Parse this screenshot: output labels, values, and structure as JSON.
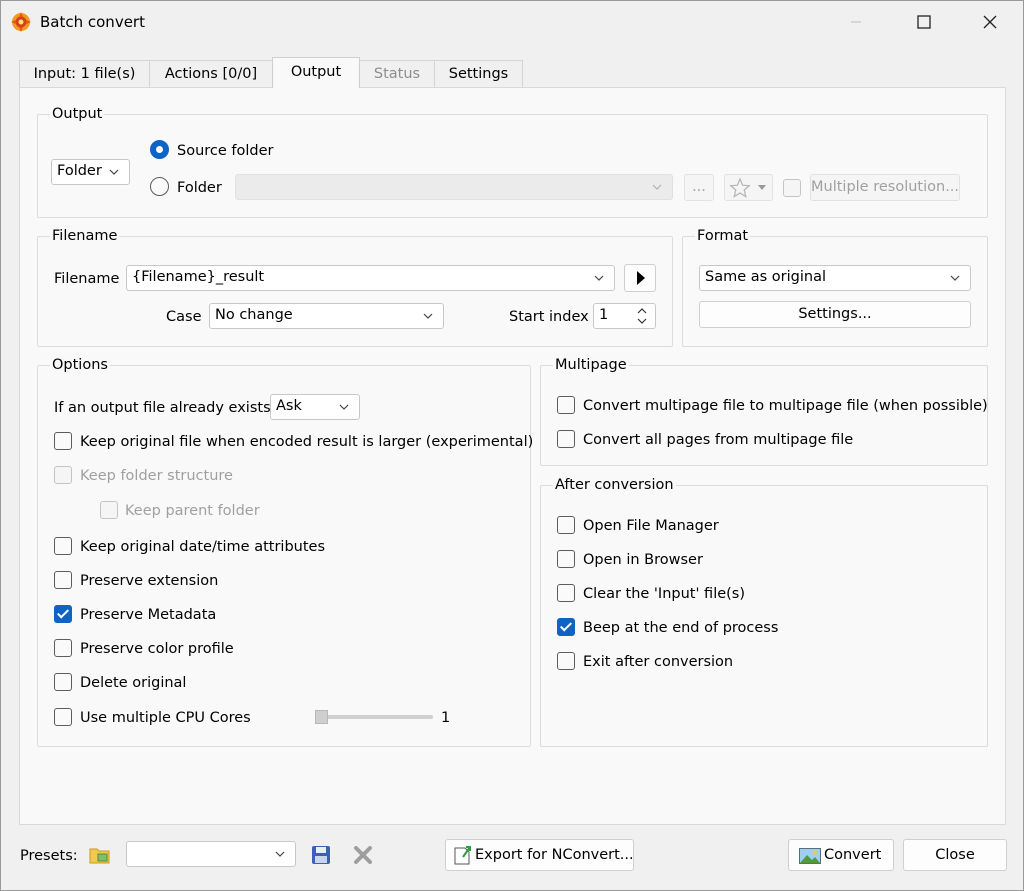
{
  "window": {
    "title": "Batch convert"
  },
  "tabs": [
    {
      "label": "Input: 1 file(s)"
    },
    {
      "label": "Actions [0/0]"
    },
    {
      "label": "Output"
    },
    {
      "label": "Status"
    },
    {
      "label": "Settings"
    }
  ],
  "output": {
    "group_label": "Output",
    "mode_select": "Folder",
    "source_folder_label": "Source folder",
    "folder_label": "Folder",
    "folder_value": "",
    "browse_label": "...",
    "multiple_resolution_label": "Multiple resolution..."
  },
  "filename": {
    "group_label": "Filename",
    "label": "Filename",
    "value": "{Filename}_result",
    "case_label": "Case",
    "case_value": "No change",
    "start_index_label": "Start index",
    "start_index_value": "1"
  },
  "format": {
    "group_label": "Format",
    "value": "Same as original",
    "settings_button": "Settings..."
  },
  "options": {
    "group_label": "Options",
    "exists_label": "If an output file already exists",
    "exists_value": "Ask",
    "keep_original_larger": "Keep original file when encoded result is larger (experimental)",
    "keep_folder_structure": "Keep folder structure",
    "keep_parent_folder": "Keep parent folder",
    "keep_datetime": "Keep original date/time attributes",
    "preserve_extension": "Preserve extension",
    "preserve_metadata": "Preserve Metadata",
    "preserve_color_profile": "Preserve color profile",
    "delete_original": "Delete original",
    "use_multiple_cpu": "Use multiple CPU Cores",
    "cpu_cores_value": "1"
  },
  "multipage": {
    "group_label": "Multipage",
    "convert_multipage": "Convert multipage file to multipage file (when possible)",
    "convert_all_pages": "Convert all pages from multipage file"
  },
  "after_conversion": {
    "group_label": "After conversion",
    "open_file_manager": "Open File Manager",
    "open_in_browser": "Open in Browser",
    "clear_input": "Clear the 'Input' file(s)",
    "beep": "Beep at the end of process",
    "exit_after": "Exit after conversion"
  },
  "bottom": {
    "presets_label": "Presets:",
    "presets_value": "",
    "export_label": "Export for NConvert...",
    "convert_label": "Convert",
    "close_label": "Close"
  },
  "colors": {
    "accent": "#0f63c4",
    "panel": "#f9f9f9",
    "window": "#f0f0f0"
  }
}
